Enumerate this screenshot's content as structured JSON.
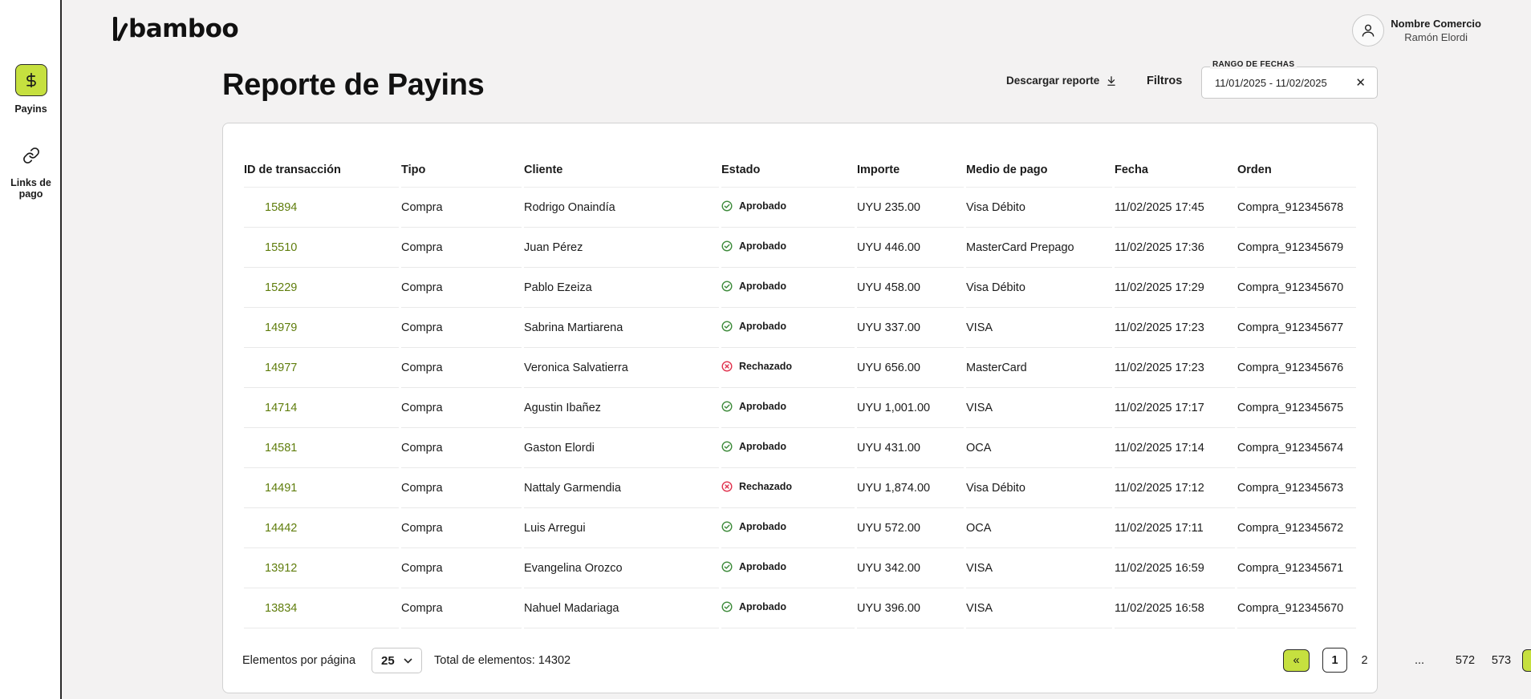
{
  "app": {
    "logo_text": "bamboo"
  },
  "sidebar": {
    "items": [
      {
        "label": "Payins",
        "icon": "dollar-icon",
        "active": true
      },
      {
        "label": "Links de pago",
        "icon": "link-icon",
        "active": false
      }
    ]
  },
  "user": {
    "company": "Nombre Comercio",
    "name": "Ramón Elordi",
    "icon": "user-icon"
  },
  "header": {
    "title": "Reporte de Payins",
    "download_label": "Descargar reporte",
    "filters_label": "Filtros",
    "date_range": {
      "label": "RANGO DE FECHAS",
      "value": "11/01/2025 - 11/02/2025",
      "clear_symbol": "✕"
    }
  },
  "table": {
    "columns": [
      "ID de transacción",
      "Tipo",
      "Cliente",
      "Estado",
      "Importe",
      "Medio de pago",
      "Fecha",
      "Orden"
    ],
    "rows": [
      {
        "id": "15894",
        "tipo": "Compra",
        "cliente": "Rodrigo Onaindía",
        "estado": "Aprobado",
        "importe": "UYU 235.00",
        "medio": "Visa Débito",
        "fecha": "11/02/2025 17:45",
        "orden": "Compra_912345678"
      },
      {
        "id": "15510",
        "tipo": "Compra",
        "cliente": "Juan Pérez",
        "estado": "Aprobado",
        "importe": "UYU 446.00",
        "medio": "MasterCard Prepago",
        "fecha": "11/02/2025 17:36",
        "orden": "Compra_912345679"
      },
      {
        "id": "15229",
        "tipo": "Compra",
        "cliente": "Pablo Ezeiza",
        "estado": "Aprobado",
        "importe": "UYU 458.00",
        "medio": "Visa Débito",
        "fecha": "11/02/2025 17:29",
        "orden": "Compra_912345670"
      },
      {
        "id": "14979",
        "tipo": "Compra",
        "cliente": "Sabrina Martiarena",
        "estado": "Aprobado",
        "importe": "UYU 337.00",
        "medio": "VISA",
        "fecha": "11/02/2025 17:23",
        "orden": "Compra_912345677"
      },
      {
        "id": "14977",
        "tipo": "Compra",
        "cliente": "Veronica Salvatierra",
        "estado": "Rechazado",
        "importe": "UYU 656.00",
        "medio": "MasterCard",
        "fecha": "11/02/2025 17:23",
        "orden": "Compra_912345676"
      },
      {
        "id": "14714",
        "tipo": "Compra",
        "cliente": "Agustin Ibañez",
        "estado": "Aprobado",
        "importe": "UYU 1,001.00",
        "medio": "VISA",
        "fecha": "11/02/2025 17:17",
        "orden": "Compra_912345675"
      },
      {
        "id": "14581",
        "tipo": "Compra",
        "cliente": "Gaston Elordi",
        "estado": "Aprobado",
        "importe": "UYU 431.00",
        "medio": "OCA",
        "fecha": "11/02/2025 17:14",
        "orden": "Compra_912345674"
      },
      {
        "id": "14491",
        "tipo": "Compra",
        "cliente": "Nattaly Garmendia",
        "estado": "Rechazado",
        "importe": "UYU 1,874.00",
        "medio": "Visa Débito",
        "fecha": "11/02/2025 17:12",
        "orden": "Compra_912345673"
      },
      {
        "id": "14442",
        "tipo": "Compra",
        "cliente": "Luis Arregui",
        "estado": "Aprobado",
        "importe": "UYU 572.00",
        "medio": "OCA",
        "fecha": "11/02/2025 17:11",
        "orden": "Compra_912345672"
      },
      {
        "id": "13912",
        "tipo": "Compra",
        "cliente": "Evangelina Orozco",
        "estado": "Aprobado",
        "importe": "UYU 342.00",
        "medio": "VISA",
        "fecha": "11/02/2025 16:59",
        "orden": "Compra_912345671"
      },
      {
        "id": "13834",
        "tipo": "Compra",
        "cliente": "Nahuel Madariaga",
        "estado": "Aprobado",
        "importe": "UYU 396.00",
        "medio": "VISA",
        "fecha": "11/02/2025 16:58",
        "orden": "Compra_912345670"
      }
    ]
  },
  "footer": {
    "per_page_label": "Elementos por página",
    "per_page_value": "25",
    "total_label": "Total de elementos: 14302",
    "pagination": {
      "prev": "«",
      "next": "»",
      "pages": [
        "1",
        "2",
        "...",
        "572",
        "573"
      ],
      "current": "1"
    }
  },
  "colors": {
    "accent": "#c6e03f",
    "id_link": "#5f7d0c",
    "approved": "#3d8a3a",
    "rejected": "#e0334e"
  }
}
